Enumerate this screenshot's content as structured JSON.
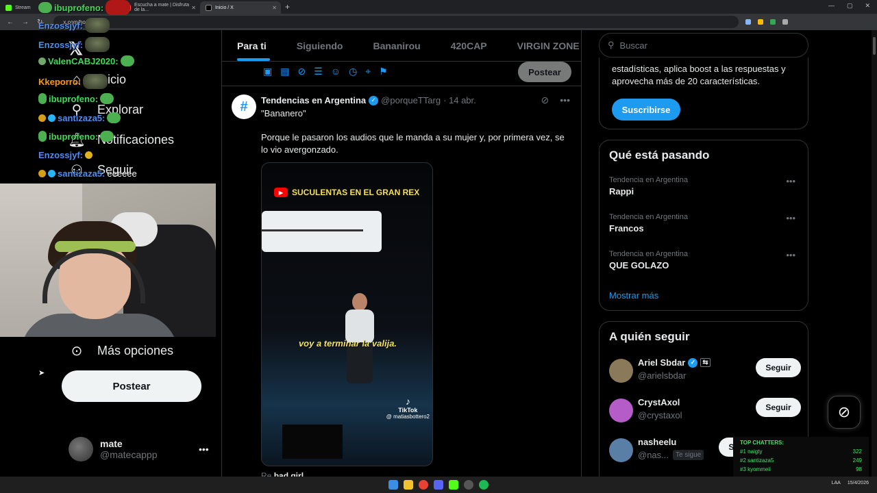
{
  "browser": {
    "tabs": [
      {
        "label": "Stream",
        "color": "#53fc18"
      },
      {
        "label": "Escucha a mate | Disfruta de la...",
        "color": "#ff4444"
      },
      {
        "label": "Inicio / X",
        "color": "#ffffff"
      }
    ],
    "url": "x.com/home",
    "new_tab": "+"
  },
  "left_nav": {
    "logo": "𝕏",
    "items": [
      {
        "label": "Inicio",
        "icon": "home-icon"
      },
      {
        "label": "Explorar",
        "icon": "search-icon"
      },
      {
        "label": "Notificaciones",
        "icon": "bell-icon"
      },
      {
        "label": "Seguir",
        "icon": "person-plus-icon"
      },
      {
        "label": "Más opciones",
        "icon": "more-circle-icon"
      }
    ],
    "post_button": "Postear",
    "profile": {
      "name": "mate",
      "handle": "@matecappp",
      "menu": "•••"
    }
  },
  "chat_overlay": {
    "lines": [
      {
        "user": "ibuprofeno:",
        "color": "#3ddc57",
        "msg": ""
      },
      {
        "user": "Enzossjyf:",
        "color": "#4f8df5",
        "msg": ""
      },
      {
        "user": "Enzossjyf:",
        "color": "#4f8df5",
        "msg": ""
      },
      {
        "user": "ValenCABJ2020:",
        "color": "#3ddc57",
        "msg": ""
      },
      {
        "user": "Kkeporro:",
        "color": "#ff9900",
        "msg": ""
      },
      {
        "user": "ibuprofeno:",
        "color": "#3ddc57",
        "msg": ""
      },
      {
        "user": "santizaza5:",
        "color": "#4f8df5",
        "msg": ""
      },
      {
        "user": "ibuprofeno:",
        "color": "#3ddc57",
        "msg": ""
      },
      {
        "user": "Enzossjyf:",
        "color": "#4f8df5",
        "msg": ""
      },
      {
        "user": "santizaza5:",
        "color": "#4f8df5",
        "msg": "eeeeee"
      }
    ]
  },
  "feed": {
    "tabs": [
      "Para ti",
      "Siguiendo",
      "Bananirou",
      "420CAP",
      "VIRGIN ZONE"
    ],
    "active_tab": "Para ti",
    "composer_post_button": "Postear",
    "tweet": {
      "avatar_glyph": "#",
      "name": "Tendencias en Argentina",
      "handle": "@porqueTTarg",
      "date": "· 14 abr.",
      "title": "\"Bananero\"",
      "text": "Porque le pasaron los audios que le manda a su mujer y, por primera vez, se lo vio avergonzado.",
      "video": {
        "banner": "SUCULENTAS EN EL GRAN REX",
        "subtitle": "voy a terminar la valija.",
        "tiktok": "TikTok",
        "tiktok_handle": "@ matiasbottero2"
      },
      "below": "Re",
      "below_bold": "bad girl"
    }
  },
  "right": {
    "search_placeholder": "Buscar",
    "premium_text": "estadísticas, aplica boost a las respuestas y aprovecha más de 20 características.",
    "subscribe": "Suscribirse",
    "trends_title": "Qué está pasando",
    "trends": [
      {
        "context": "Tendencia en Argentina",
        "name": "Rappi"
      },
      {
        "context": "Tendencia en Argentina",
        "name": "Francos"
      },
      {
        "context": "Tendencia en Argentina",
        "name": "QUE GOLAZO"
      }
    ],
    "show_more": "Mostrar más",
    "follow_title": "A quién seguir",
    "suggestions": [
      {
        "name": "Ariel Sbdar",
        "handle": "@arielsbdar",
        "follows_you": "",
        "button": "Seguir",
        "avatar_color": "#8a7a5a"
      },
      {
        "name": "CrystAxol",
        "handle": "@crystaxol",
        "follows_you": "",
        "button": "Seguir",
        "avatar_color": "#b55cc9"
      },
      {
        "name": "nasheelu",
        "handle": "@nas...",
        "follows_you": "Te sigue",
        "button": "Seguir",
        "avatar_color": "#5a7fa6"
      }
    ]
  },
  "top_chatters": {
    "title": "TOP CHATTERS:",
    "rows": [
      {
        "rank": "#1 naigty",
        "count": "322"
      },
      {
        "rank": "#2 santizaza5",
        "count": "249"
      },
      {
        "rank": "#3 kyommeii",
        "count": "98"
      }
    ]
  },
  "taskbar": {
    "lang": "LAA",
    "date": "15/4/2026"
  }
}
